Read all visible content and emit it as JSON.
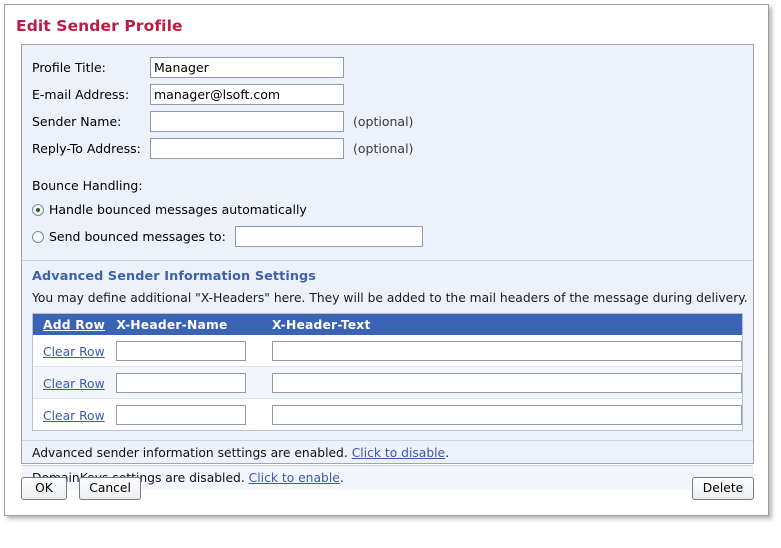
{
  "window": {
    "title": "Edit Sender Profile"
  },
  "form": {
    "fields": [
      {
        "label": "Profile Title:",
        "value": "Manager",
        "optional": ""
      },
      {
        "label": "E-mail Address:",
        "value": "manager@lsoft.com",
        "optional": ""
      },
      {
        "label": "Sender Name:",
        "value": "",
        "optional": "(optional)"
      },
      {
        "label": "Reply-To Address:",
        "value": "",
        "optional": "(optional)"
      }
    ]
  },
  "bounce": {
    "heading": "Bounce Handling:",
    "option_auto": "Handle bounced messages automatically",
    "option_send_to": "Send bounced messages to:",
    "send_to_value": "",
    "selected": "auto"
  },
  "advanced": {
    "heading": "Advanced Sender Information Settings",
    "description": "You may define additional \"X-Headers\" here. They will be added to the mail headers of the message during delivery.",
    "table": {
      "columns": [
        "Add Row",
        "X-Header-Name",
        "X-Header-Text"
      ],
      "add_row_label": "Add Row",
      "clear_row_label": "Clear Row",
      "rows": [
        {
          "action": "Clear Row",
          "name": "",
          "text": ""
        },
        {
          "action": "Clear Row",
          "name": "",
          "text": ""
        },
        {
          "action": "Clear Row",
          "name": "",
          "text": ""
        }
      ]
    }
  },
  "status": [
    {
      "text_before": "Advanced sender information settings are enabled.",
      "link": "Click to disable",
      "text_after": "."
    },
    {
      "text_before": "DomainKeys settings are disabled.",
      "link": "Click to enable",
      "text_after": "."
    }
  ],
  "footer": {
    "ok": "OK",
    "cancel": "Cancel",
    "delete": "Delete"
  },
  "colors": {
    "title": "#bd1b42",
    "heading_blue": "#3c62ab",
    "table_header": "#3b63b5",
    "panel_bg": "#edf1f9",
    "link": "#3b5ba8"
  }
}
